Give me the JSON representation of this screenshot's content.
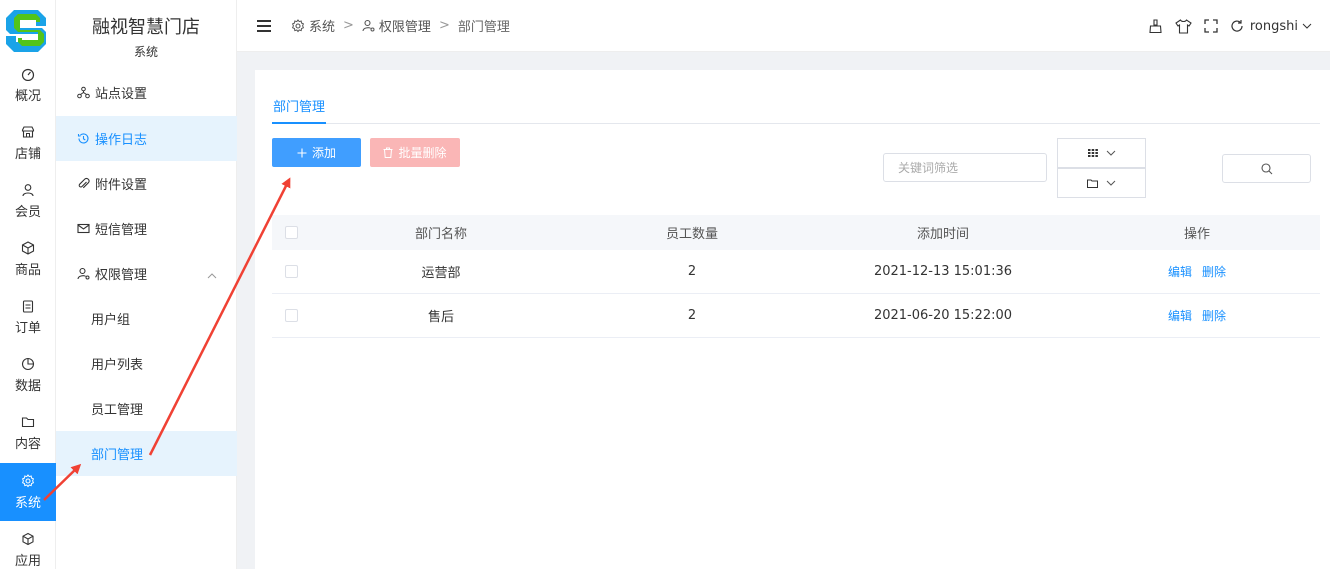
{
  "rail": {
    "items": [
      {
        "label": "概况",
        "icon": "dashboard-icon"
      },
      {
        "label": "店铺",
        "icon": "store-icon"
      },
      {
        "label": "会员",
        "icon": "member-icon"
      },
      {
        "label": "商品",
        "icon": "product-box-icon"
      },
      {
        "label": "订单",
        "icon": "order-icon"
      },
      {
        "label": "数据",
        "icon": "pie-chart-icon"
      },
      {
        "label": "内容",
        "icon": "folder-icon"
      },
      {
        "label": "系统",
        "icon": "gear-icon"
      },
      {
        "label": "应用",
        "icon": "app-cube-icon"
      }
    ],
    "active_color": "#1890ff"
  },
  "sidebar": {
    "shop_name": "融视智慧门店",
    "section": "系统",
    "items": [
      {
        "label": "站点设置",
        "icon": "sitemap-icon"
      },
      {
        "label": "操作日志",
        "icon": "history-icon"
      },
      {
        "label": "附件设置",
        "icon": "paperclip-icon"
      },
      {
        "label": "短信管理",
        "icon": "mail-icon"
      },
      {
        "label": "权限管理",
        "icon": "user-lock-icon"
      },
      {
        "label": "用户组"
      },
      {
        "label": "用户列表"
      },
      {
        "label": "员工管理"
      },
      {
        "label": "部门管理"
      }
    ]
  },
  "topbar": {
    "breadcrumb": [
      "系统",
      "权限管理",
      "部门管理"
    ],
    "username": "rongshi",
    "icons": [
      "clean-icon",
      "shirt-icon",
      "fullscreen-icon",
      "refresh-icon"
    ]
  },
  "main": {
    "tab": "部门管理",
    "add_label": "添加",
    "batch_delete_label": "批量删除",
    "search_placeholder": "关键词筛选",
    "table": {
      "headers": [
        "部门名称",
        "员工数量",
        "添加时间",
        "操作"
      ],
      "rows": [
        {
          "name": "运营部",
          "count": "2",
          "time": "2021-12-13 15:01:36",
          "edit": "编辑",
          "delete": "删除"
        },
        {
          "name": "售后",
          "count": "2",
          "time": "2021-06-20 15:22:00",
          "edit": "编辑",
          "delete": "删除"
        }
      ]
    }
  },
  "colors": {
    "primary": "#1890ff",
    "add_button": "#409eff",
    "danger_disabled": "#fab6b6",
    "annotation_arrow": "#f04134"
  }
}
